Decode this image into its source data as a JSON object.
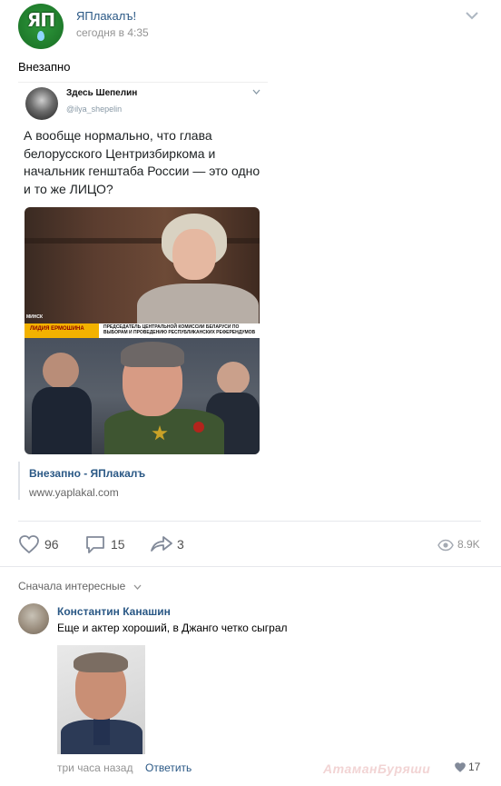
{
  "post": {
    "author": "ЯПлакалъ!",
    "avatar_logo": "ЯП",
    "time": "сегодня в 4:35",
    "text": "Внезапно"
  },
  "tweet": {
    "name": "Здесь Шепелин",
    "handle": "@ilya_shepelin",
    "text": "А вообще нормально, что глава белорусского Центризбиркома и начальник генштаба России — это одно и то же ЛИЦО?",
    "photo": {
      "chyron_name": "ЛИДИЯ ЕРМОШИНА",
      "chyron_title": "ПРЕДСЕДАТЕЛЬ ЦЕНТРАЛЬНОЙ КОМИССИИ БЕЛАРУСИ ПО ВЫБОРАМ И ПРОВЕДЕНИЮ РЕСПУБЛИКАНСКИХ РЕФЕРЕНДУМОВ",
      "chyron_tag": "МИНСК"
    }
  },
  "link": {
    "title": "Внезапно - ЯПлакалъ",
    "url": "www.yaplakal.com"
  },
  "actions": {
    "likes": "96",
    "comments": "15",
    "shares": "3",
    "views": "8.9K"
  },
  "comments_sort": "Сначала интересные",
  "comment": {
    "author": "Константин Канашин",
    "text": "Еще и актер хороший, в Джанго четко сыграл",
    "time": "три часа назад",
    "reply": "Ответить",
    "likes": "17"
  },
  "watermark": "АтаманБуряши",
  "icons": {
    "menu": "chevron-down-icon",
    "like": "heart-icon",
    "comment": "speech-bubble-icon",
    "share": "share-arrow-icon",
    "views": "eye-icon"
  },
  "colors": {
    "link": "#2a5885",
    "muted": "#939393",
    "accent_green": "#1f7a2b"
  }
}
